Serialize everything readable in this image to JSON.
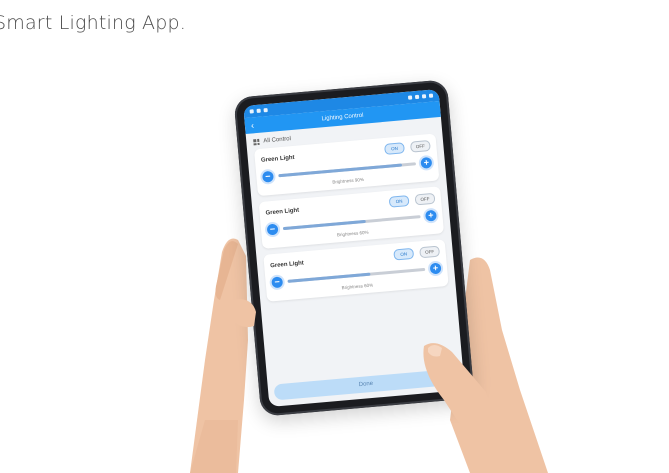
{
  "caption": "Smart Lighting App.",
  "app": {
    "title": "Lighting Control",
    "all_control_label": "All Control",
    "confirm_label": "Done",
    "lights": [
      {
        "name": "Green Light",
        "on_label": "ON",
        "off_label": "OFF",
        "brightness_label": "Brightness",
        "brightness": 0.9,
        "brightness_text": "90%"
      },
      {
        "name": "Green Light",
        "on_label": "ON",
        "off_label": "OFF",
        "brightness_label": "Brightness",
        "brightness": 0.6,
        "brightness_text": "60%"
      },
      {
        "name": "Green Light",
        "on_label": "ON",
        "off_label": "OFF",
        "brightness_label": "Brightness",
        "brightness": 0.6,
        "brightness_text": "60%"
      }
    ]
  },
  "colors": {
    "accent": "#2196f3",
    "tablet": "#1b1c20",
    "skin": "#efc3a4"
  }
}
